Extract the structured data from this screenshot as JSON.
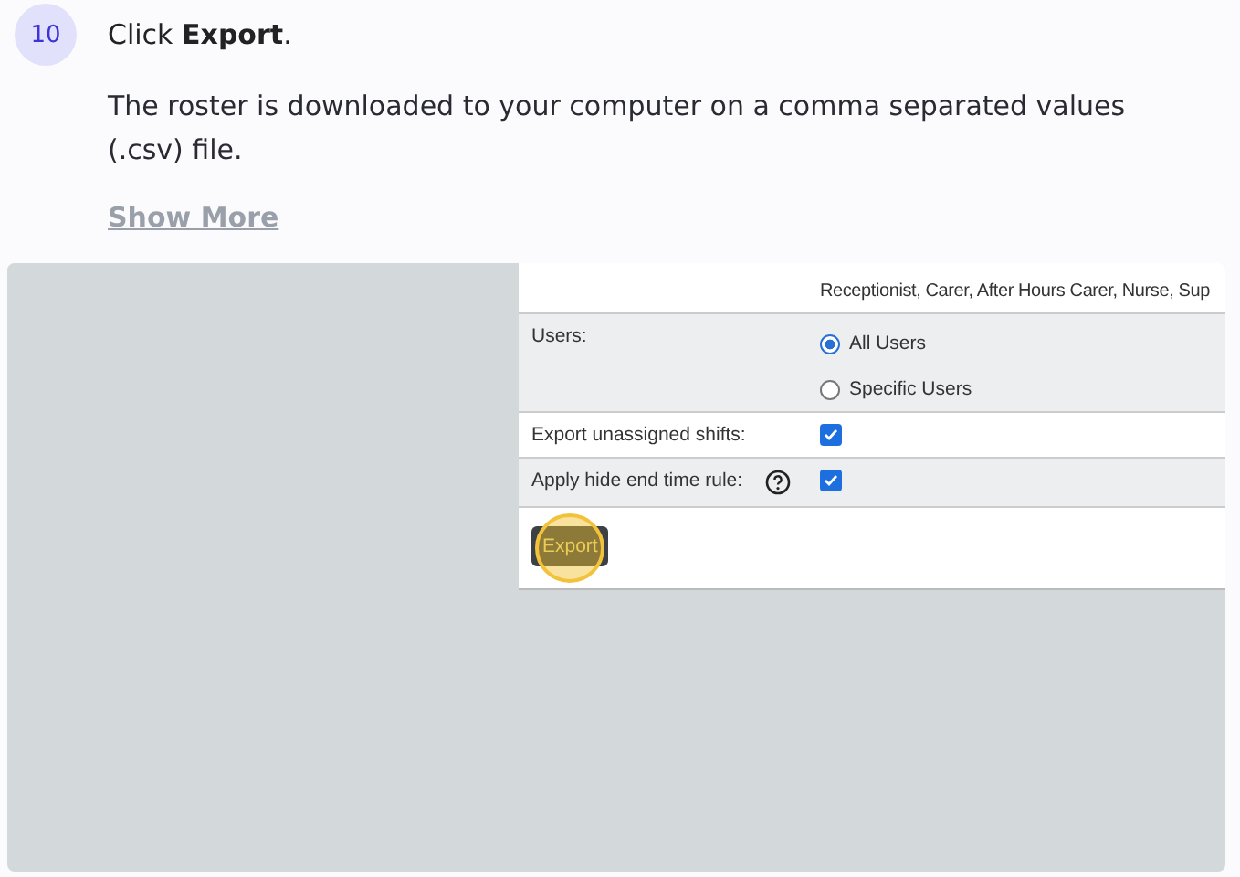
{
  "step": {
    "number": "10",
    "title": "Click **Export**.",
    "description": "The roster is downloaded to your computer on a comma separated values (.csv) file.",
    "show_more": "Show More"
  },
  "screenshot": {
    "groups_value": "Receptionist, Carer, After Hours Carer, Nurse, Sup",
    "users": {
      "label": "Users:",
      "options": [
        {
          "label": "All Users",
          "selected": true
        },
        {
          "label": "Specific Users",
          "selected": false
        }
      ]
    },
    "checkboxes": [
      {
        "label": "Export unassigned shifts:",
        "checked": true,
        "help": false
      },
      {
        "label": "Apply hide end time rule:",
        "checked": true,
        "help": true
      }
    ],
    "button": "Export"
  }
}
